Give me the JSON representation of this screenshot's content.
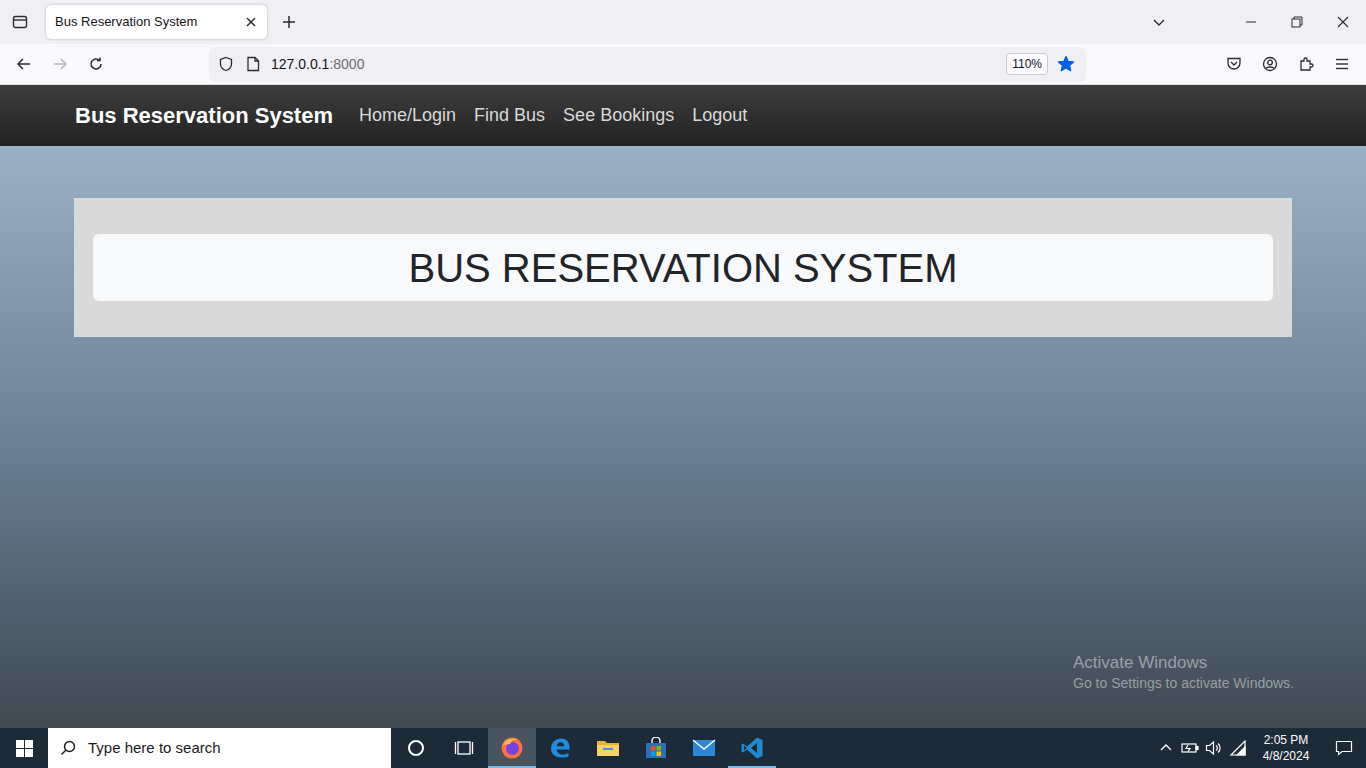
{
  "browser": {
    "tabs": [
      {
        "label": "Bus Reservation System",
        "selected": true
      }
    ],
    "forward_enabled": false,
    "url_host": "127.0.0.1",
    "url_port": ":8000",
    "zoom": "110%",
    "bookmarked": true
  },
  "page": {
    "brand": "Bus Reservation System",
    "nav": [
      {
        "label": "Home/Login"
      },
      {
        "label": "Find Bus"
      },
      {
        "label": "See Bookings"
      },
      {
        "label": "Logout"
      }
    ],
    "heading": "BUS RESERVATION SYSTEM"
  },
  "watermark": {
    "title": "Activate Windows",
    "subtitle": "Go to Settings to activate Windows."
  },
  "taskbar": {
    "search_placeholder": "Type here to search",
    "apps": [
      {
        "kind": "cortana",
        "active": false,
        "running": false
      },
      {
        "kind": "taskview",
        "active": false,
        "running": false
      },
      {
        "kind": "firefox",
        "active": true,
        "running": true
      },
      {
        "kind": "edge",
        "active": false,
        "running": false
      },
      {
        "kind": "explorer",
        "active": false,
        "running": false
      },
      {
        "kind": "store",
        "active": false,
        "running": false
      },
      {
        "kind": "mail",
        "active": false,
        "running": false
      },
      {
        "kind": "vscode",
        "active": false,
        "running": true
      }
    ],
    "tray": [
      {
        "kind": "chevron"
      },
      {
        "kind": "battery"
      },
      {
        "kind": "volume"
      },
      {
        "kind": "wifi"
      }
    ],
    "time": "2:05 PM",
    "date": "4/8/2024"
  }
}
